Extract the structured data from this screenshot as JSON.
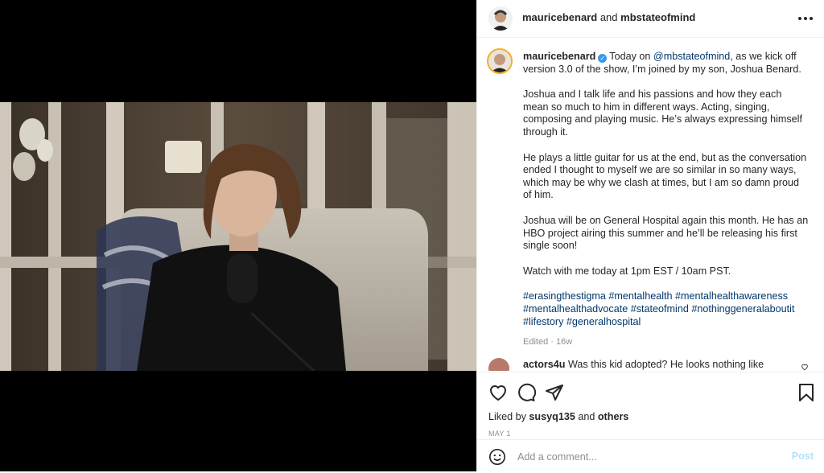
{
  "post": {
    "header": {
      "author": "mauricebenard",
      "connector": "and",
      "collaborator": "mbstateofmind",
      "more_icon": "more-horizontal-icon"
    },
    "caption": {
      "username": "mauricebenard",
      "verified_icon": "verified-badge-icon",
      "intro_before_mention": "Today on",
      "mention": "@mbstateofmind",
      "intro_after_mention": ", as we kick off version 3.0 of the show, I’m joined by my son, Joshua Benard.",
      "paragraphs": [
        "Joshua and I talk life and his passions and how they each mean so much to him in different ways. Acting, singing, composing and playing music. He’s always expressing himself through it.",
        "He plays a little guitar for us at the end, but as the conversation ended I thought to myself we are so similar in so many ways, which may be why we clash at times, but I am so damn proud of him.",
        "Joshua will be on General Hospital again this month. He has an HBO project airing this summer and he’ll be releasing his first single soon!",
        "Watch with me today at 1pm EST / 10am PST."
      ],
      "hashtags": "#erasingthestigma #mentalhealth #mentalhealthawareness #mentalhealthadvocate #stateofmind #nothinggeneralaboutit #lifestory #generalhospital",
      "edited": "Edited · 16w"
    },
    "comment": {
      "username": "actors4u",
      "text": "Was this kid adopted? He looks nothing like"
    },
    "actions": {
      "like_icon": "heart-icon",
      "comment_icon": "comment-icon",
      "share_icon": "share-icon",
      "save_icon": "bookmark-icon"
    },
    "likes": {
      "prefix": "Liked by",
      "user": "susyq135",
      "connector": "and",
      "others": "others"
    },
    "date": "MAY 1",
    "add_comment": {
      "emoji_icon": "emoji-icon",
      "placeholder": "Add a comment...",
      "post_label": "Post"
    }
  },
  "colors": {
    "link": "#00376b",
    "verified": "#3897f0",
    "post_disabled": "#b2dffc",
    "muted": "#8e8e8e"
  }
}
